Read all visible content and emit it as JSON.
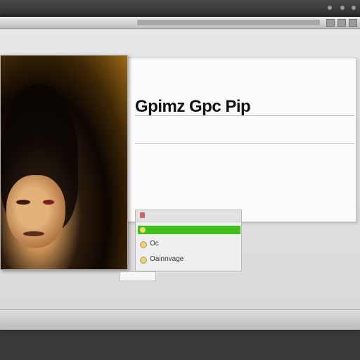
{
  "topbar": {
    "left_text": "",
    "mid_text": "",
    "right_text": ""
  },
  "window": {
    "tab_label": "",
    "tab_label_2": ""
  },
  "article": {
    "heading": "Gpimz Gpc Pip",
    "subheading": "",
    "body": ""
  },
  "list": {
    "header": "",
    "items": [
      {
        "label": "Oc"
      },
      {
        "label": "Oainnvage"
      }
    ]
  },
  "small_input": "",
  "status": ""
}
